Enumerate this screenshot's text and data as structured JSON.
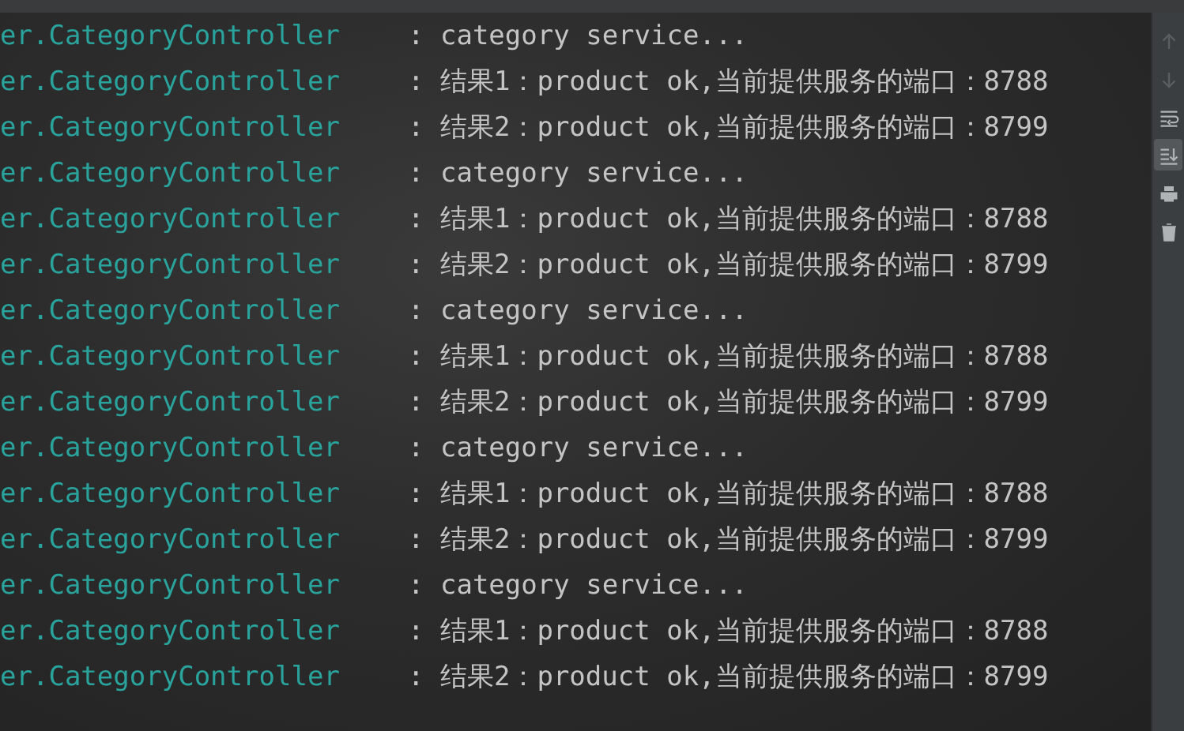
{
  "console": {
    "lines": [
      {
        "logger": "er.CategoryController",
        "message": ": category service..."
      },
      {
        "logger": "er.CategoryController",
        "message": ": 结果1：product ok,当前提供服务的端口：8788"
      },
      {
        "logger": "er.CategoryController",
        "message": ": 结果2：product ok,当前提供服务的端口：8799"
      },
      {
        "logger": "er.CategoryController",
        "message": ": category service..."
      },
      {
        "logger": "er.CategoryController",
        "message": ": 结果1：product ok,当前提供服务的端口：8788"
      },
      {
        "logger": "er.CategoryController",
        "message": ": 结果2：product ok,当前提供服务的端口：8799"
      },
      {
        "logger": "er.CategoryController",
        "message": ": category service..."
      },
      {
        "logger": "er.CategoryController",
        "message": ": 结果1：product ok,当前提供服务的端口：8788"
      },
      {
        "logger": "er.CategoryController",
        "message": ": 结果2：product ok,当前提供服务的端口：8799"
      },
      {
        "logger": "er.CategoryController",
        "message": ": category service..."
      },
      {
        "logger": "er.CategoryController",
        "message": ": 结果1：product ok,当前提供服务的端口：8788"
      },
      {
        "logger": "er.CategoryController",
        "message": ": 结果2：product ok,当前提供服务的端口：8799"
      },
      {
        "logger": "er.CategoryController",
        "message": ": category service..."
      },
      {
        "logger": "er.CategoryController",
        "message": ": 结果1：product ok,当前提供服务的端口：8788"
      },
      {
        "logger": "er.CategoryController",
        "message": ": 结果2：product ok,当前提供服务的端口：8799"
      }
    ]
  },
  "toolbar": [
    {
      "kind": "up",
      "disabled": true,
      "selected": false
    },
    {
      "kind": "down",
      "disabled": true,
      "selected": false
    },
    {
      "kind": "wrap",
      "disabled": false,
      "selected": false
    },
    {
      "kind": "scroll-end",
      "disabled": false,
      "selected": true
    },
    {
      "kind": "print",
      "disabled": false,
      "selected": false
    },
    {
      "kind": "trash",
      "disabled": false,
      "selected": false
    }
  ]
}
